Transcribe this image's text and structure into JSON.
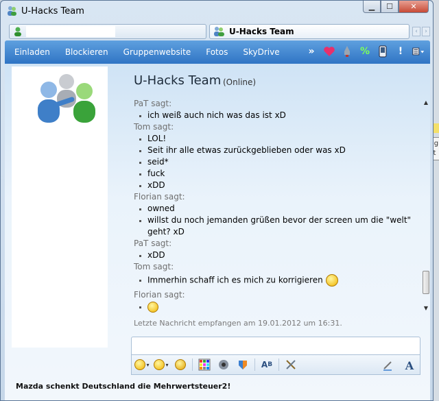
{
  "window": {
    "title": "U-Hacks Team"
  },
  "tabs": {
    "active_label": "U-Hacks Team"
  },
  "toolbar": {
    "links": [
      "Einladen",
      "Blockieren",
      "Gruppenwebsite",
      "Fotos",
      "SkyDrive"
    ],
    "more": "»",
    "icons": [
      "heart-icon",
      "rocket-icon",
      "percent-icon",
      "phone-icon",
      "alert-icon",
      "menu-icon"
    ]
  },
  "header": {
    "name": "U-Hacks Team",
    "status": "(Online)"
  },
  "conversation": [
    {
      "sender": "PaT sagt:",
      "messages": [
        "ich weiß auch nich was das ist xD"
      ]
    },
    {
      "sender": "Tom sagt:",
      "messages": [
        "LOL!",
        "Seit ihr alle etwas zurückgeblieben oder was xD",
        "seid*",
        "fuck",
        "xDD"
      ]
    },
    {
      "sender": "Florian sagt:",
      "messages": [
        "owned",
        "willst du noch jemanden grüßen bevor der screen um die \"welt\" geht? xD"
      ]
    },
    {
      "sender": "PaT sagt:",
      "messages": [
        "xDD"
      ]
    },
    {
      "sender": "Tom sagt:",
      "messages": [
        "Immerhin schaff ich es mich zu korrigieren"
      ]
    },
    {
      "sender": "Florian sagt:",
      "messages": [
        ""
      ]
    }
  ],
  "last_message": "Letzte Nachricht empfangen am 19.01.2012 um 16:31.",
  "footer_text": "Mazda schenkt Deutschland die Mehrwertsteuer2!",
  "tooltip": "Die g\nKont",
  "colors": {
    "toolbar": "#2f74c4",
    "accent_green": "#2ea82e"
  }
}
